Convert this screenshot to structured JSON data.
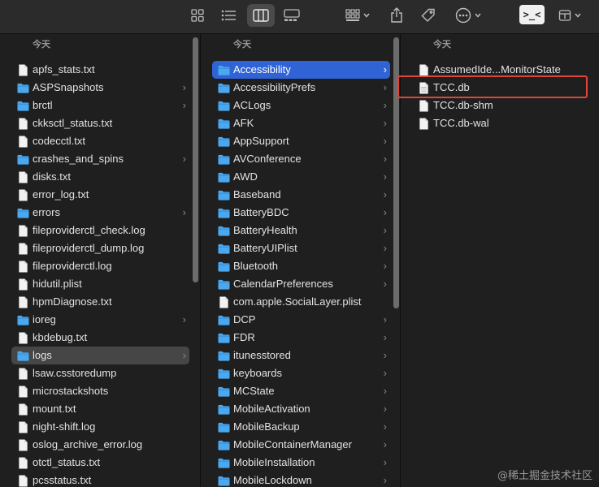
{
  "colors": {
    "folder": "#4aa8f0",
    "selection": "#2f63d6",
    "highlight": "#e0453a",
    "file": "#f2f2f2"
  },
  "toolbar": {
    "items": [
      {
        "icon": "icon-view-icon"
      },
      {
        "icon": "list-view-icon"
      },
      {
        "icon": "column-view-icon",
        "selected": true
      },
      {
        "icon": "gallery-view-icon"
      },
      {
        "icon": "group-icon"
      },
      {
        "icon": "share-icon"
      },
      {
        "icon": "tag-icon"
      },
      {
        "icon": "more-actions-icon"
      },
      {
        "icon": "terminal-icon",
        "label": ">_<"
      },
      {
        "icon": "archive-icon"
      }
    ]
  },
  "columns": [
    {
      "header": "今天",
      "items": [
        {
          "name": "apfs_stats.txt",
          "kind": "file"
        },
        {
          "name": "ASPSnapshots",
          "kind": "folder",
          "arrow": "›"
        },
        {
          "name": "brctl",
          "kind": "folder",
          "arrow": "›"
        },
        {
          "name": "ckksctl_status.txt",
          "kind": "file"
        },
        {
          "name": "codecctl.txt",
          "kind": "file"
        },
        {
          "name": "crashes_and_spins",
          "kind": "folder",
          "arrow": "›"
        },
        {
          "name": "disks.txt",
          "kind": "file"
        },
        {
          "name": "error_log.txt",
          "kind": "file"
        },
        {
          "name": "errors",
          "kind": "folder",
          "arrow": "›"
        },
        {
          "name": "fileproviderctl_check.log",
          "kind": "file"
        },
        {
          "name": "fileproviderctl_dump.log",
          "kind": "file"
        },
        {
          "name": "fileproviderctl.log",
          "kind": "file"
        },
        {
          "name": "hidutil.plist",
          "kind": "file"
        },
        {
          "name": "hpmDiagnose.txt",
          "kind": "file"
        },
        {
          "name": "ioreg",
          "kind": "folder",
          "arrow": "›"
        },
        {
          "name": "kbdebug.txt",
          "kind": "file"
        },
        {
          "name": "logs",
          "kind": "folder",
          "arrow": "›",
          "selected": "gray"
        },
        {
          "name": "lsaw.csstoredump",
          "kind": "file"
        },
        {
          "name": "microstackshots",
          "kind": "file"
        },
        {
          "name": "mount.txt",
          "kind": "file"
        },
        {
          "name": "night-shift.log",
          "kind": "file"
        },
        {
          "name": "oslog_archive_error.log",
          "kind": "file"
        },
        {
          "name": "otctl_status.txt",
          "kind": "file"
        },
        {
          "name": "pcsstatus.txt",
          "kind": "file"
        }
      ]
    },
    {
      "header": "今天",
      "items": [
        {
          "name": "Accessibility",
          "kind": "folder",
          "arrow": "›",
          "selected": "blue"
        },
        {
          "name": "AccessibilityPrefs",
          "kind": "folder",
          "arrow": "›"
        },
        {
          "name": "ACLogs",
          "kind": "folder",
          "arrow": "›"
        },
        {
          "name": "AFK",
          "kind": "folder",
          "arrow": "›"
        },
        {
          "name": "AppSupport",
          "kind": "folder",
          "arrow": "›"
        },
        {
          "name": "AVConference",
          "kind": "folder",
          "arrow": "›"
        },
        {
          "name": "AWD",
          "kind": "folder",
          "arrow": "›"
        },
        {
          "name": "Baseband",
          "kind": "folder",
          "arrow": "›"
        },
        {
          "name": "BatteryBDC",
          "kind": "folder",
          "arrow": "›"
        },
        {
          "name": "BatteryHealth",
          "kind": "folder",
          "arrow": "›"
        },
        {
          "name": "BatteryUIPlist",
          "kind": "folder",
          "arrow": "›"
        },
        {
          "name": "Bluetooth",
          "kind": "folder",
          "arrow": "›"
        },
        {
          "name": "CalendarPreferences",
          "kind": "folder",
          "arrow": "›"
        },
        {
          "name": "com.apple.SocialLayer.plist",
          "kind": "file"
        },
        {
          "name": "DCP",
          "kind": "folder",
          "arrow": "›"
        },
        {
          "name": "FDR",
          "kind": "folder",
          "arrow": "›"
        },
        {
          "name": "itunesstored",
          "kind": "folder",
          "arrow": "›"
        },
        {
          "name": "keyboards",
          "kind": "folder",
          "arrow": "›"
        },
        {
          "name": "MCState",
          "kind": "folder",
          "arrow": "›"
        },
        {
          "name": "MobileActivation",
          "kind": "folder",
          "arrow": "›"
        },
        {
          "name": "MobileBackup",
          "kind": "folder",
          "arrow": "›"
        },
        {
          "name": "MobileContainerManager",
          "kind": "folder",
          "arrow": "›"
        },
        {
          "name": "MobileInstallation",
          "kind": "folder",
          "arrow": "›"
        },
        {
          "name": "MobileLockdown",
          "kind": "folder",
          "arrow": "›"
        }
      ]
    },
    {
      "header": "今天",
      "items": [
        {
          "name": "AssumedIde...MonitorState",
          "kind": "file"
        },
        {
          "name": "TCC.db",
          "kind": "db"
        },
        {
          "name": "TCC.db-shm",
          "kind": "file"
        },
        {
          "name": "TCC.db-wal",
          "kind": "file"
        }
      ]
    }
  ],
  "watermark": "@稀土掘金技术社区"
}
